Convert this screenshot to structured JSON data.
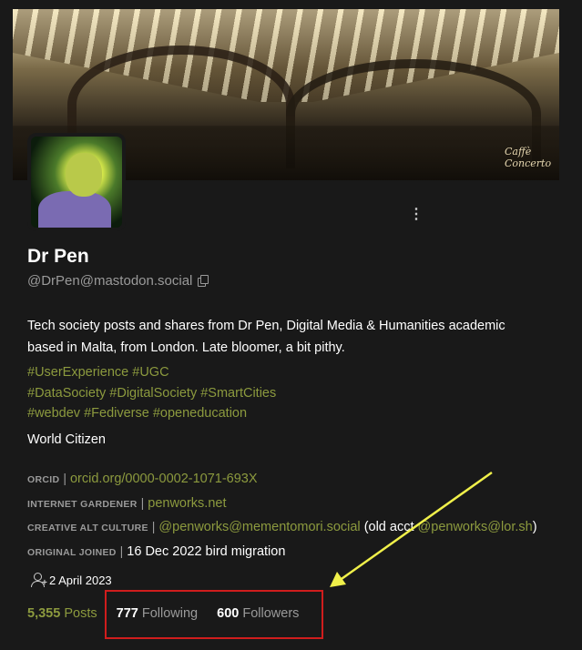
{
  "profile": {
    "display_name": "Dr Pen",
    "handle": "@DrPen@mastodon.social",
    "bio": "Tech society posts and shares from Dr Pen, Digital Media & Humanities academic based in Malta, from London. Late bloomer, a bit pithy.",
    "hashtag_lines": [
      [
        "#UserExperience",
        "#UGC"
      ],
      [
        "#DataSociety",
        "#DigitalSociety",
        "#SmartCities"
      ],
      [
        "#webdev",
        "#Fediverse",
        "#openeducation"
      ]
    ],
    "tagline": "World Citizen",
    "banner_sign": "Caffè Concerto",
    "menu_glyph": "⋮"
  },
  "fields": [
    {
      "key": "ORCID",
      "value": "orcid.org/0000-0002-1071-693X"
    },
    {
      "key": "INTERNET GARDENER",
      "value": "penworks.net"
    },
    {
      "key": "CREATIVE ALT CULTURE",
      "value_link": "@penworks@mementomori.social",
      "value_text": "(old acct ",
      "value_link2": "@penworks@lor.sh",
      "value_text2": ")"
    },
    {
      "key": "ORIGINAL JOINED",
      "value": "16 Dec 2022 bird migration"
    }
  ],
  "field_separator": "|",
  "joined": "2 April 2023",
  "stats": {
    "posts_count": "5,355",
    "posts_label": "Posts",
    "following_count": "777",
    "following_label": "Following",
    "followers_count": "600",
    "followers_label": "Followers"
  },
  "icons": {
    "menu": "more-vertical-icon",
    "copy": "copy-icon",
    "joined": "person-add-icon"
  },
  "colors": {
    "background": "#191919",
    "accent": "#8c9a3e",
    "muted": "#9a9a9a",
    "highlight_box": "#d01d1d",
    "annotation_arrow": "#f0f04a"
  }
}
